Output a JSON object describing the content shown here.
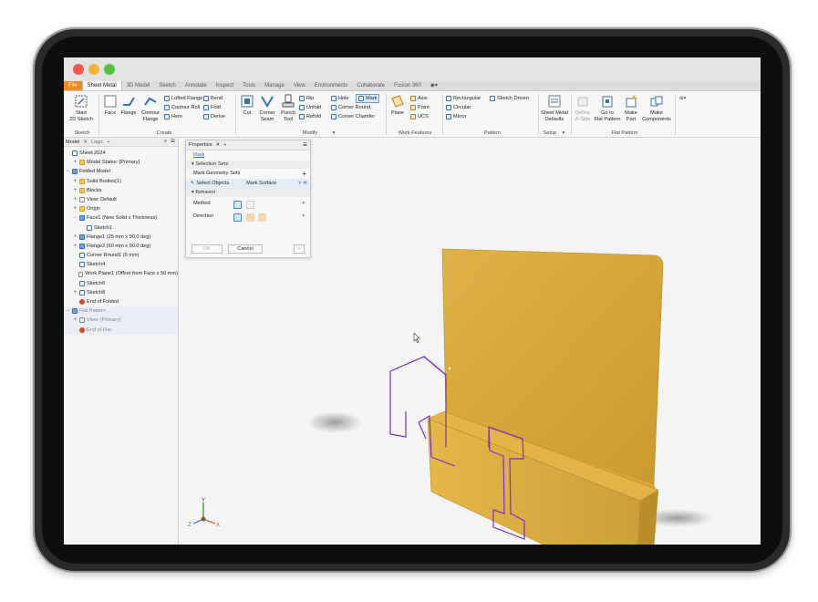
{
  "ribbon_tabs": [
    "File",
    "Sheet Metal",
    "3D Model",
    "Sketch",
    "Annotate",
    "Inspect",
    "Tools",
    "Manage",
    "View",
    "Environments",
    "Collaborate",
    "Fusion 360"
  ],
  "active_tab": "Sheet Metal",
  "ribbon": {
    "start_sketch": [
      "Start",
      "2D Sketch"
    ],
    "face": "Face",
    "flange": "Flange",
    "contour_flange": [
      "Contour",
      "Flange"
    ],
    "lofted_flange": "Lofted Flange",
    "contour_roll": "Contour Roll",
    "hem": "Hem",
    "bend": "Bend",
    "fold": "Fold",
    "derive": "Derive",
    "cut": "Cut",
    "corner_seam": [
      "Corner",
      "Seam"
    ],
    "punch_tool": [
      "Punch",
      "Tool"
    ],
    "rip": "Rip",
    "unfold": "Unfold",
    "refold": "Refold",
    "hole": "Hole",
    "mark": "Mark",
    "corner_round": "Corner Round",
    "corner_chamfer": "Corner Chamfer",
    "plane": "Plane",
    "axis": "Axis",
    "point": "Point",
    "ucs": "UCS",
    "rectangular": "Rectangular",
    "circular": "Circular",
    "mirror": "Mirror",
    "sketch_driven": "Sketch Driven",
    "sheet_metal_defaults": [
      "Sheet Metal",
      "Defaults"
    ],
    "define_a_side": [
      "Define",
      "A-Side"
    ],
    "go_to_flat_pattern": [
      "Go to",
      "Flat Pattern"
    ],
    "make_part": [
      "Make",
      "Part"
    ],
    "make_components": [
      "Make",
      "Components"
    ],
    "groups": {
      "sketch": "Sketch",
      "create": "Create",
      "modify": "Modify",
      "work_features": "Work Features",
      "pattern": "Pattern",
      "setup": "Setup",
      "flat_pattern": "Flat Pattern"
    }
  },
  "browser": {
    "tabs": [
      "Model",
      "Logic"
    ],
    "items": [
      {
        "label": "Sheet 2024",
        "exp": "",
        "indent": 0,
        "icon": "doc"
      },
      {
        "label": "Model States: [Primary]",
        "exp": "+",
        "indent": 1,
        "icon": "fld"
      },
      {
        "label": "Folded Model",
        "exp": "−",
        "indent": 0,
        "icon": "blu"
      },
      {
        "label": "Solid Bodies(1)",
        "exp": "+",
        "indent": 1,
        "icon": "fld"
      },
      {
        "label": "Blocks",
        "exp": "+",
        "indent": 1,
        "icon": "fld"
      },
      {
        "label": "View: Default",
        "exp": "+",
        "indent": 1,
        "icon": "grey"
      },
      {
        "label": "Origin",
        "exp": "+",
        "indent": 1,
        "icon": "fld"
      },
      {
        "label": "Face1 (New Solid  x Thickness)",
        "exp": "−",
        "indent": 1,
        "icon": "blu"
      },
      {
        "label": "Sketch1",
        "exp": "",
        "indent": 2,
        "icon": "doc"
      },
      {
        "label": "Flange1 (25 mm x 90.0 deg)",
        "exp": "+",
        "indent": 1,
        "icon": "blu"
      },
      {
        "label": "Flange2 (60 mm x 90.0 deg)",
        "exp": "+",
        "indent": 1,
        "icon": "blu"
      },
      {
        "label": "Corner Round1 (6 mm)",
        "exp": "",
        "indent": 1,
        "icon": "doc"
      },
      {
        "label": "Sketch4",
        "exp": "",
        "indent": 1,
        "icon": "doc"
      },
      {
        "label": "Work Plane1 (Offset from Face x 50 mm)",
        "exp": "",
        "indent": 1,
        "icon": "grey"
      },
      {
        "label": "Sketch6",
        "exp": "",
        "indent": 1,
        "icon": "doc"
      },
      {
        "label": "Sketch8",
        "exp": "+",
        "indent": 1,
        "icon": "doc"
      },
      {
        "label": "End of Folded",
        "exp": "",
        "indent": 1,
        "icon": "end"
      },
      {
        "label": "Flat Pattern",
        "exp": "−",
        "indent": 0,
        "icon": "blu",
        "dim": true,
        "sel": true
      },
      {
        "label": "View: [Primary]",
        "exp": "+",
        "indent": 1,
        "icon": "grey",
        "dim": true,
        "sel": true
      },
      {
        "label": "End of Flat",
        "exp": "",
        "indent": 1,
        "icon": "end",
        "dim": true,
        "sel": true
      }
    ]
  },
  "properties": {
    "tab": "Properties",
    "feature_link": "Mark",
    "selection_sets": "Selection Sets",
    "mark_geometry_sets": "Mark Geometry Sets",
    "select_objects": "Select Objects",
    "mark_surface": "Mark Surface",
    "behavior": "Behavior",
    "method": "Method",
    "direction": "Direction",
    "ok": "OK",
    "cancel": "Cancel"
  },
  "triad": {
    "y": "Y",
    "x": "X",
    "z": "Z"
  },
  "colors": {
    "accent": "#f08a1a",
    "part": "#d9a834",
    "sketch": "#7a2fc9",
    "link": "#2f6cc2"
  }
}
